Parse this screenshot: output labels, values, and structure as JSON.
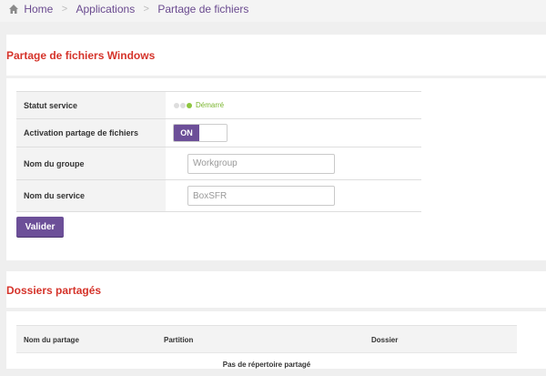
{
  "breadcrumb": {
    "items": [
      "Home",
      "Applications",
      "Partage de fichiers"
    ],
    "separator": ">"
  },
  "windows_share": {
    "title": "Partage de fichiers Windows",
    "rows": {
      "service_status": {
        "label": "Statut service",
        "value": "Démarré"
      },
      "file_sharing": {
        "label": "Activation partage de fichiers",
        "toggle": "ON"
      },
      "group_name": {
        "label": "Nom du groupe",
        "value": "Workgroup"
      },
      "service_name": {
        "label": "Nom du service",
        "value": "BoxSFR"
      }
    },
    "submit_label": "Valider"
  },
  "shared_folders": {
    "title": "Dossiers partagés",
    "columns": [
      "Nom du partage",
      "Partition",
      "Dossier"
    ],
    "empty_message": "Pas de répertoire partagé"
  },
  "colors": {
    "accent": "#6c4f98",
    "title_red": "#d5332a",
    "status_green": "#8dc63f"
  }
}
